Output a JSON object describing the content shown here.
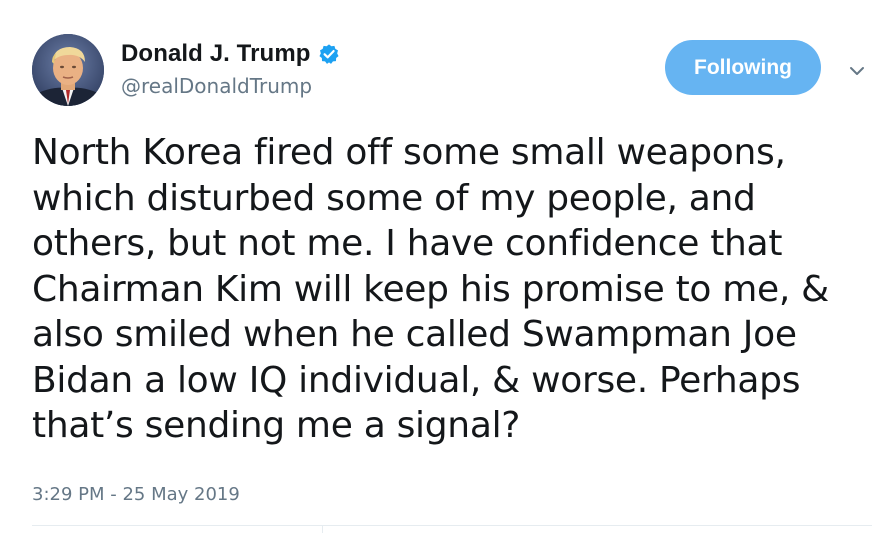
{
  "user": {
    "display_name": "Donald J. Trump",
    "handle": "@realDonaldTrump",
    "verified": true,
    "avatar_icon": "profile-photo"
  },
  "follow_button": {
    "label": "Following",
    "color": "#66b4f2"
  },
  "menu_icon": "chevron-down-icon",
  "tweet": {
    "text": "North Korea fired off some small weapons,\nwhich disturbed some of my people, and\nothers, but not me. I have confidence that\nChairman Kim will keep his promise to me, &\nalso smiled when he called Swampman Joe\nBidan a low IQ individual, & worse. Perhaps\nthat’s sending me a signal?",
    "timestamp": "3:29 PM - 25 May 2019"
  },
  "colors": {
    "text_primary": "#14171a",
    "text_secondary": "#657786",
    "verified_badge": "#1da1f2",
    "divider": "#e6ecf0"
  }
}
